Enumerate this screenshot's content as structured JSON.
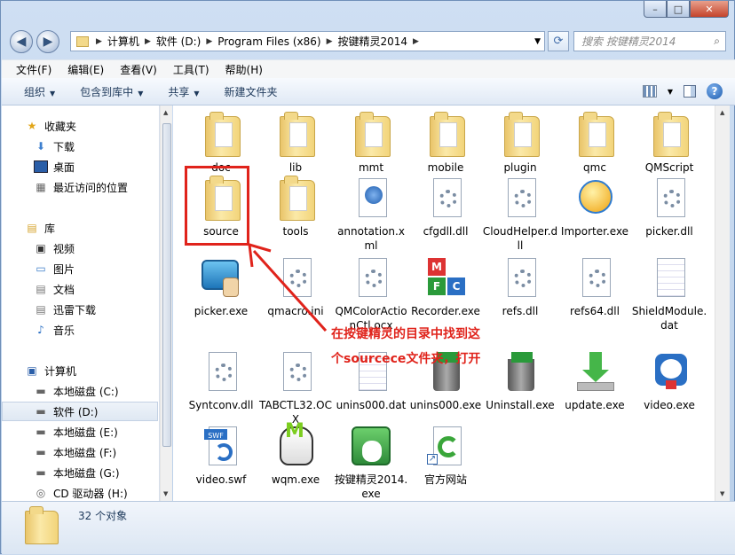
{
  "window": {
    "controls": {
      "minimize": "–",
      "maximize": "□",
      "close": "✕"
    }
  },
  "nav": {
    "back": "◀",
    "forward": "▶"
  },
  "address": {
    "crumbs": [
      "计算机",
      "软件 (D:)",
      "Program Files (x86)",
      "按键精灵2014"
    ]
  },
  "search": {
    "placeholder": "搜索 按键精灵2014"
  },
  "menu": [
    "文件(F)",
    "编辑(E)",
    "查看(V)",
    "工具(T)",
    "帮助(H)"
  ],
  "toolbar": {
    "organize": "组织",
    "include": "包含到库中",
    "share": "共享",
    "new_folder": "新建文件夹"
  },
  "sidebar": {
    "favorites": {
      "label": "收藏夹",
      "items": [
        "下载",
        "桌面",
        "最近访问的位置"
      ]
    },
    "libraries": {
      "label": "库",
      "items": [
        "视频",
        "图片",
        "文档",
        "迅雷下载",
        "音乐"
      ]
    },
    "computer": {
      "label": "计算机",
      "items": [
        "本地磁盘 (C:)",
        "软件 (D:)",
        "本地磁盘 (E:)",
        "本地磁盘 (F:)",
        "本地磁盘 (G:)",
        "CD 驱动器 (H:)"
      ]
    }
  },
  "files": [
    {
      "name": "doc",
      "icon": "folder-icon"
    },
    {
      "name": "lib",
      "icon": "folder-icon"
    },
    {
      "name": "mmt",
      "icon": "folder-icon"
    },
    {
      "name": "mobile",
      "icon": "folder-icon"
    },
    {
      "name": "plugin",
      "icon": "folder-icon"
    },
    {
      "name": "qmc",
      "icon": "folder-icon"
    },
    {
      "name": "QMScript",
      "icon": "folder-icon"
    },
    {
      "name": "source",
      "icon": "folder-icon"
    },
    {
      "name": "tools",
      "icon": "folder-icon"
    },
    {
      "name": "annotation.xml",
      "icon": "xml-file-icon"
    },
    {
      "name": "cfgdll.dll",
      "icon": "dll-file-icon"
    },
    {
      "name": "CloudHelper.dll",
      "icon": "dll-file-icon"
    },
    {
      "name": "Importer.exe",
      "icon": "importer-app-icon"
    },
    {
      "name": "picker.dll",
      "icon": "dll-file-icon"
    },
    {
      "name": "picker.exe",
      "icon": "picker-app-icon"
    },
    {
      "name": "qmacro.ini",
      "icon": "ini-file-icon"
    },
    {
      "name": "QMColorActionCtl.ocx",
      "icon": "ocx-file-icon"
    },
    {
      "name": "Recorder.exe",
      "icon": "recorder-app-icon"
    },
    {
      "name": "refs.dll",
      "icon": "dll-file-icon"
    },
    {
      "name": "refs64.dll",
      "icon": "dll-file-icon"
    },
    {
      "name": "ShieldModule.dat",
      "icon": "dat-file-icon"
    },
    {
      "name": "Syntconv.dll",
      "icon": "dll-file-icon"
    },
    {
      "name": "TABCTL32.OCX",
      "icon": "ocx-file-icon"
    },
    {
      "name": "unins000.dat",
      "icon": "dat-file-icon"
    },
    {
      "name": "unins000.exe",
      "icon": "uninstall-app-icon"
    },
    {
      "name": "Uninstall.exe",
      "icon": "uninstall-app-icon"
    },
    {
      "name": "update.exe",
      "icon": "update-app-icon"
    },
    {
      "name": "video.exe",
      "icon": "video-app-icon"
    },
    {
      "name": "video.swf",
      "icon": "swf-file-icon"
    },
    {
      "name": "wqm.exe",
      "icon": "wqm-app-icon"
    },
    {
      "name": "按键精灵2014.exe",
      "icon": "anjian-app-icon"
    },
    {
      "name": "官方网站",
      "icon": "ie-shortcut-icon"
    }
  ],
  "status": {
    "count": "32 个对象"
  },
  "annotation": {
    "line1": "在按键精灵的目录中找到这",
    "line2": "个sourcece文件夹，打开"
  },
  "colors": {
    "annotation": "#e0231b",
    "folder": "#f3d98a"
  }
}
